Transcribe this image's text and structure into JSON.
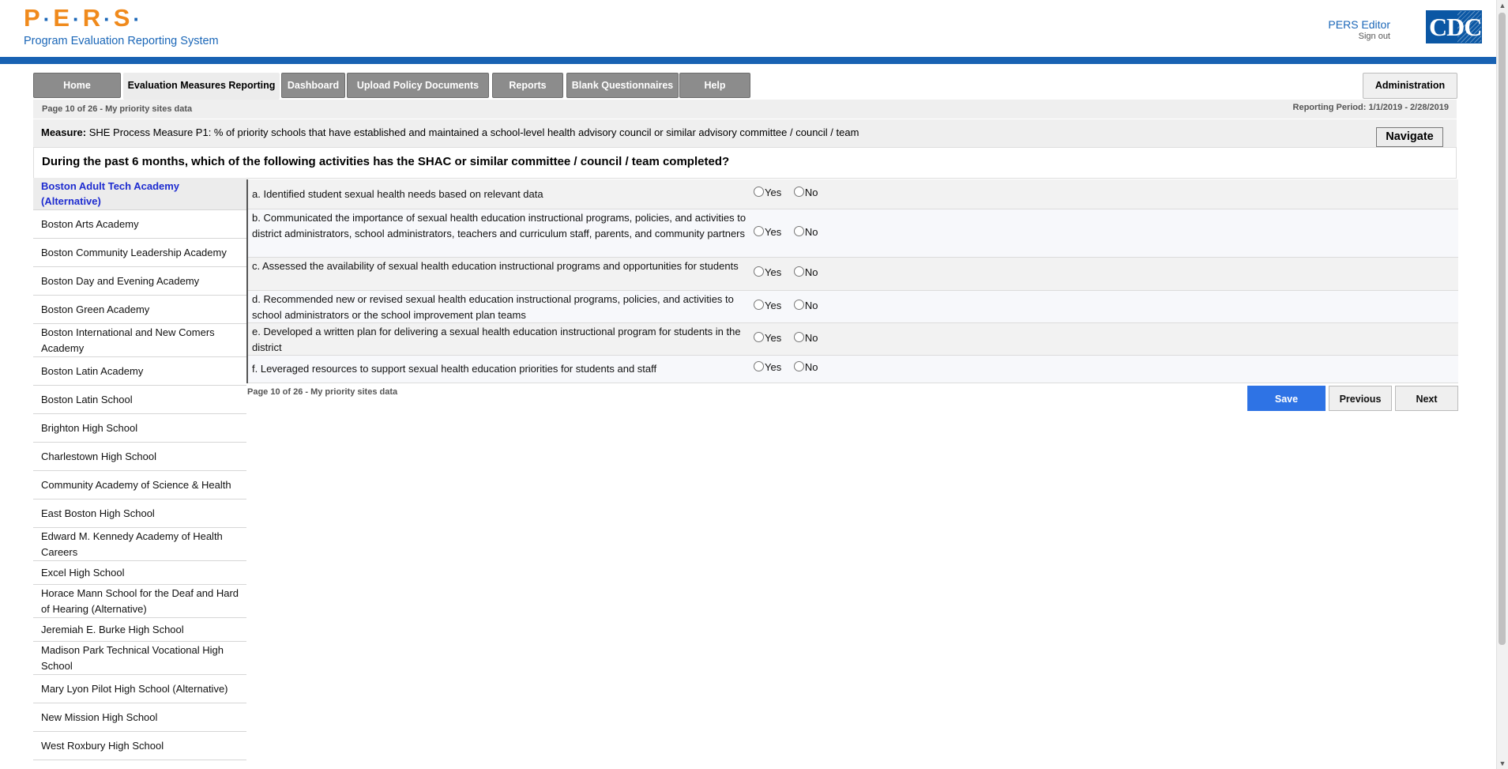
{
  "header": {
    "logo_letters": [
      "P",
      "E",
      "R",
      "S"
    ],
    "logo_subtitle": "Program Evaluation Reporting System",
    "user_name": "PERS Editor",
    "sign_out": "Sign out",
    "agency_logo_text": "CDC"
  },
  "nav": {
    "tabs": [
      {
        "label": "Home"
      },
      {
        "label": "Evaluation Measures Reporting",
        "active": true
      },
      {
        "label": "Dashboard"
      },
      {
        "label": "Upload Policy Documents"
      },
      {
        "label": "Reports"
      },
      {
        "label": "Blank Questionnaires"
      },
      {
        "label": "Help"
      }
    ],
    "admin_label": "Administration"
  },
  "info": {
    "page_info": "Page 10 of 26 - My priority sites data",
    "reporting_period": "Reporting Period: 1/1/2019 - 2/28/2019"
  },
  "measure": {
    "label": "Measure:",
    "text": "SHE Process Measure P1: % of priority schools that have established and maintained a school-level health advisory council or similar advisory committee / council / team",
    "navigate_label": "Navigate"
  },
  "question": "During the past 6 months, which of the following activities has the SHAC or similar committee / council / team completed?",
  "schools": [
    {
      "name": "Boston Adult Tech Academy (Alternative)",
      "selected": true
    },
    {
      "name": "Boston Arts Academy"
    },
    {
      "name": "Boston Community Leadership Academy"
    },
    {
      "name": "Boston Day and Evening Academy"
    },
    {
      "name": "Boston Green Academy"
    },
    {
      "name": "Boston International and New Comers Academy"
    },
    {
      "name": "Boston Latin Academy"
    },
    {
      "name": "Boston Latin School"
    },
    {
      "name": "Brighton High School"
    },
    {
      "name": "Charlestown High School"
    },
    {
      "name": "Community Academy of Science & Health"
    },
    {
      "name": "East Boston High School"
    },
    {
      "name": "Edward M. Kennedy Academy of Health Careers"
    },
    {
      "name": "Excel High School"
    },
    {
      "name": "Horace Mann School for the Deaf and Hard of Hearing (Alternative)"
    },
    {
      "name": "Jeremiah E. Burke High School"
    },
    {
      "name": "Madison Park Technical Vocational High School"
    },
    {
      "name": "Mary Lyon Pilot High School (Alternative)"
    },
    {
      "name": "New Mission High School"
    },
    {
      "name": "West Roxbury High School"
    }
  ],
  "items": [
    {
      "text": "a. Identified student sexual health needs based on relevant data"
    },
    {
      "text": "b. Communicated the importance of sexual health education instructional programs, policies, and activities to district administrators, school administrators, teachers and curriculum staff, parents, and community partners"
    },
    {
      "text": "c. Assessed the availability of sexual health education instructional programs and opportunities for students"
    },
    {
      "text": "d. Recommended new or revised sexual health education instructional programs, policies, and activities to school administrators or the school improvement plan teams"
    },
    {
      "text": "e. Developed a written plan for delivering a sexual health education instructional program for students in the district"
    },
    {
      "text": "f. Leveraged resources to support sexual health education priorities for students and staff"
    }
  ],
  "options": {
    "yes": "Yes",
    "no": "No"
  },
  "footer": {
    "page_info": "Page 10 of 26 - My priority sites data",
    "save": "Save",
    "previous": "Previous",
    "next": "Next"
  }
}
